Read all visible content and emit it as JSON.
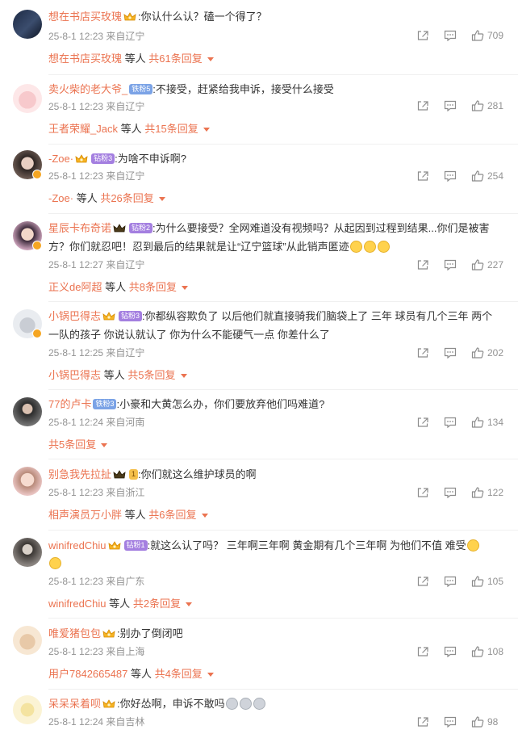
{
  "comments": [
    {
      "user": "想在书店买玫瑰",
      "text": ":你认什么认？磕一个得了？",
      "time": "25-8-1 12:23",
      "location": "来自辽宁",
      "likes": "709",
      "reply_name": "想在书店买玫瑰",
      "reply_mid": "等人",
      "reply_count": "共61条回复"
    },
    {
      "user": "卖火柴的老大爷_",
      "level": "铁粉5",
      "text": ":不接受，赶紧给我申诉，接受什么接受",
      "time": "25-8-1 12:23",
      "location": "来自辽宁",
      "likes": "281",
      "reply_name": "王者荣耀_Jack",
      "reply_mid": "等人",
      "reply_count": "共15条回复"
    },
    {
      "user": "-Zoe·",
      "level": "钻粉3",
      "text": ":为啥不申诉啊?",
      "time": "25-8-1 12:23",
      "location": "来自辽宁",
      "likes": "254",
      "reply_name": "-Zoe·",
      "reply_mid": "等人",
      "reply_count": "共26条回复"
    },
    {
      "user": "星辰卡布奇诺",
      "level": "钻粉2",
      "text_line1": ":为什么要接受？全网难道没有视频吗？从起因到过程到结果...你们是被害",
      "text_line2": "方？你们就忍吧！忍到最后的结果就是让“辽宁篮球”从此销声匿迹",
      "time": "25-8-1 12:27",
      "location": "来自辽宁",
      "likes": "227",
      "reply_name": "正义de阿超",
      "reply_mid": "等人",
      "reply_count": "共8条回复"
    },
    {
      "user": "小锅巴得志",
      "level": "钻粉3",
      "text_line1": ":你都纵容欺负了 以后他们就直接骑我们脑袋上了 三年 球员有几个三年 两个",
      "text_line2": "一队的孩子 你说认就认了 你为什么不能硬气一点 你差什么了",
      "time": "25-8-1 12:25",
      "location": "来自辽宁",
      "likes": "202",
      "reply_name": "小锅巴得志",
      "reply_mid": "等人",
      "reply_count": "共5条回复"
    },
    {
      "user": "77的卢卡",
      "level": "铁粉3",
      "text": ":小豪和大黄怎么办，你们要放弃他们吗难道?",
      "time": "25-8-1 12:24",
      "location": "来自河南",
      "likes": "134",
      "reply_count": "共5条回复"
    },
    {
      "user": "别急我先拉扯",
      "level": "1",
      "text": ":你们就这么维护球员的啊",
      "time": "25-8-1 12:23",
      "location": "来自浙江",
      "likes": "122",
      "reply_name": "相声演员万小胖",
      "reply_mid": "等人",
      "reply_count": "共6条回复"
    },
    {
      "user": "winifredChiu",
      "level": "钻粉1",
      "text_line1": ":就这么认了吗？ 三年啊三年啊  黄金期有几个三年啊  为他们不值  难受",
      "time": "25-8-1 12:23",
      "location": "来自广东",
      "likes": "105",
      "reply_name": "winifredChiu",
      "reply_mid": "等人",
      "reply_count": "共2条回复"
    },
    {
      "user": "唯爱猪包包",
      "text": ":别办了倒闭吧",
      "time": "25-8-1 12:23",
      "location": "来自上海",
      "likes": "108",
      "reply_name": "用户7842665487",
      "reply_mid": "等人",
      "reply_count": "共4条回复"
    },
    {
      "user": "呆呆呆着呗",
      "text": ":你好怂啊，申诉不敢吗",
      "time": "25-8-1 12:24",
      "location": "来自吉林",
      "likes": "98"
    }
  ],
  "colors": {
    "username": "#eb7350",
    "meta": "#939393",
    "text": "#333333"
  },
  "icons": [
    "share-icon",
    "comment-icon",
    "like-icon"
  ]
}
